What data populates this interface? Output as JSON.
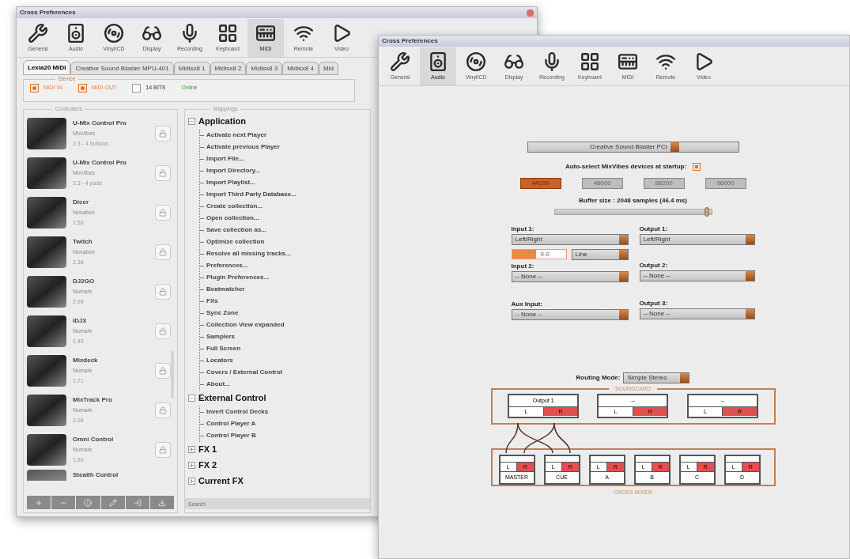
{
  "back_window": {
    "title": "Cross Preferences",
    "toolbar": [
      {
        "label": "General",
        "selected": false
      },
      {
        "label": "Audio",
        "selected": false
      },
      {
        "label": "Vinyl/CD",
        "selected": false
      },
      {
        "label": "Display",
        "selected": false
      },
      {
        "label": "Recording",
        "selected": false
      },
      {
        "label": "Keyboard",
        "selected": false
      },
      {
        "label": "MIDI",
        "selected": true
      },
      {
        "label": "Remote",
        "selected": false
      },
      {
        "label": "Video",
        "selected": false
      }
    ],
    "tabs": [
      {
        "label": "Lexia20 MIDI",
        "selected": true
      },
      {
        "label": "Creative Sound Blaster MPU-401",
        "selected": false
      },
      {
        "label": "Midisx8 1",
        "selected": false
      },
      {
        "label": "Midisx8 2",
        "selected": false
      },
      {
        "label": "Midisx8 3",
        "selected": false
      },
      {
        "label": "Midisx8 4",
        "selected": false
      },
      {
        "label": "Mid",
        "selected": false
      }
    ],
    "device": {
      "legend": "Device",
      "options": [
        {
          "label": "MIDI IN",
          "checked": true
        },
        {
          "label": "MIDI OUT",
          "checked": true
        },
        {
          "label": "14 BITS",
          "checked": false
        }
      ],
      "status": "Online"
    },
    "controllers": {
      "legend": "Controllers",
      "items": [
        {
          "name": "U-Mix Control Pro",
          "brand": "MixVibes",
          "version": "2.3 - 4 buttons"
        },
        {
          "name": "U-Mix Control Pro",
          "brand": "MixVibes",
          "version": "2.3 - 4 pads"
        },
        {
          "name": "Dicer",
          "brand": "Novation",
          "version": "1.50"
        },
        {
          "name": "Twitch",
          "brand": "Novation",
          "version": "2.36"
        },
        {
          "name": "DJ2GO",
          "brand": "Numark",
          "version": "2.09"
        },
        {
          "name": "iDJ3",
          "brand": "Numark",
          "version": "1.40"
        },
        {
          "name": "Mixdeck",
          "brand": "Numark",
          "version": "1.71"
        },
        {
          "name": "MixTrack Pro",
          "brand": "Numark",
          "version": "2.08"
        },
        {
          "name": "Omni Control",
          "brand": "Numark",
          "version": "1.90"
        },
        {
          "name": "Stealth Control"
        }
      ]
    },
    "mappings": {
      "legend": "Mappings",
      "tree": [
        {
          "label": "Application",
          "expanded": true,
          "children": [
            {
              "label": "Activate next Player"
            },
            {
              "label": "Activate previous Player"
            },
            {
              "label": "Import File..."
            },
            {
              "label": "Import Directory..."
            },
            {
              "label": "Import Playlist..."
            },
            {
              "label": "Import Third Party Database..."
            },
            {
              "label": "Create collection..."
            },
            {
              "label": "Open collection..."
            },
            {
              "label": "Save collection as..."
            },
            {
              "label": "Optimize collection"
            },
            {
              "label": "Resolve all missing tracks..."
            },
            {
              "label": "Preferences..."
            },
            {
              "label": "Plugin Preferences..."
            },
            {
              "label": "Beatmatcher"
            },
            {
              "label": "FXs"
            },
            {
              "label": "Sync Zone"
            },
            {
              "label": "Collection View expanded"
            },
            {
              "label": "Samplers"
            },
            {
              "label": "Full Screen"
            },
            {
              "label": "Locators"
            },
            {
              "label": "Covers / External Control"
            },
            {
              "label": "About..."
            }
          ]
        },
        {
          "label": "External Control",
          "expanded": true,
          "children": [
            {
              "label": "Invert Control Decks"
            },
            {
              "label": "Control Player A"
            },
            {
              "label": "Control Player B"
            }
          ]
        },
        {
          "label": "FX 1",
          "expanded": false
        },
        {
          "label": "FX 2",
          "expanded": false
        },
        {
          "label": "Current FX",
          "expanded": false
        }
      ],
      "search": {
        "placeholder": "Search"
      }
    }
  },
  "front_window": {
    "title": "Cross Preferences",
    "toolbar": [
      {
        "label": "General",
        "selected": false
      },
      {
        "label": "Audio",
        "selected": true
      },
      {
        "label": "Vinyl/CD",
        "selected": false
      },
      {
        "label": "Display",
        "selected": false
      },
      {
        "label": "Recording",
        "selected": false
      },
      {
        "label": "Keyboard",
        "selected": false
      },
      {
        "label": "MIDI",
        "selected": false
      },
      {
        "label": "Remote",
        "selected": false
      },
      {
        "label": "Video",
        "selected": false
      }
    ],
    "device_select": "Creative Sound Blaster PCI",
    "auto_select": {
      "label": "Auto-select MixVibes devices at startup:",
      "checked": true
    },
    "rate_buttons": [
      {
        "label": "44100",
        "selected": true
      },
      {
        "label": "48000",
        "selected": false
      },
      {
        "label": "88200",
        "selected": false
      },
      {
        "label": "96000",
        "selected": false
      }
    ],
    "buffer": {
      "label": "Buffer size : 2048 samples (46.4 ms)",
      "level": 0.97
    },
    "inputs": [
      {
        "label": "Input 1:",
        "value": "Left/Right"
      },
      {
        "label": "Input 2:",
        "value": "-- None --"
      },
      {
        "label": "Aux Input:",
        "value": "-- None --"
      }
    ],
    "gain": {
      "value": "0.0",
      "level": 0.45
    },
    "input_type": "Line",
    "outputs": [
      {
        "label": "Output 1:",
        "value": "Left/Right"
      },
      {
        "label": "Output 2:",
        "value": "-- None --"
      },
      {
        "label": "Output 3:",
        "value": "-- None --"
      }
    ],
    "routing": {
      "label": "Routing Mode:",
      "value": "Simple Stereo",
      "soundcard": {
        "legend": "SOUNDCARD",
        "outputs": [
          {
            "label": "Output 1",
            "left": "L",
            "right": "R"
          },
          {
            "label": "--",
            "left": "L",
            "right": "R"
          },
          {
            "label": "--",
            "left": "L",
            "right": "R"
          }
        ]
      },
      "mixer": {
        "legend": "CROSS MIXER",
        "channels": [
          {
            "label": "MASTER",
            "left": "L",
            "right": "R"
          },
          {
            "label": "CUE",
            "left": "L",
            "right": "R"
          },
          {
            "label": "A",
            "left": "L",
            "right": "R"
          },
          {
            "label": "B",
            "left": "L",
            "right": "R"
          },
          {
            "label": "C",
            "left": "L",
            "right": "R"
          },
          {
            "label": "D",
            "left": "L",
            "right": "R"
          }
        ]
      }
    }
  }
}
